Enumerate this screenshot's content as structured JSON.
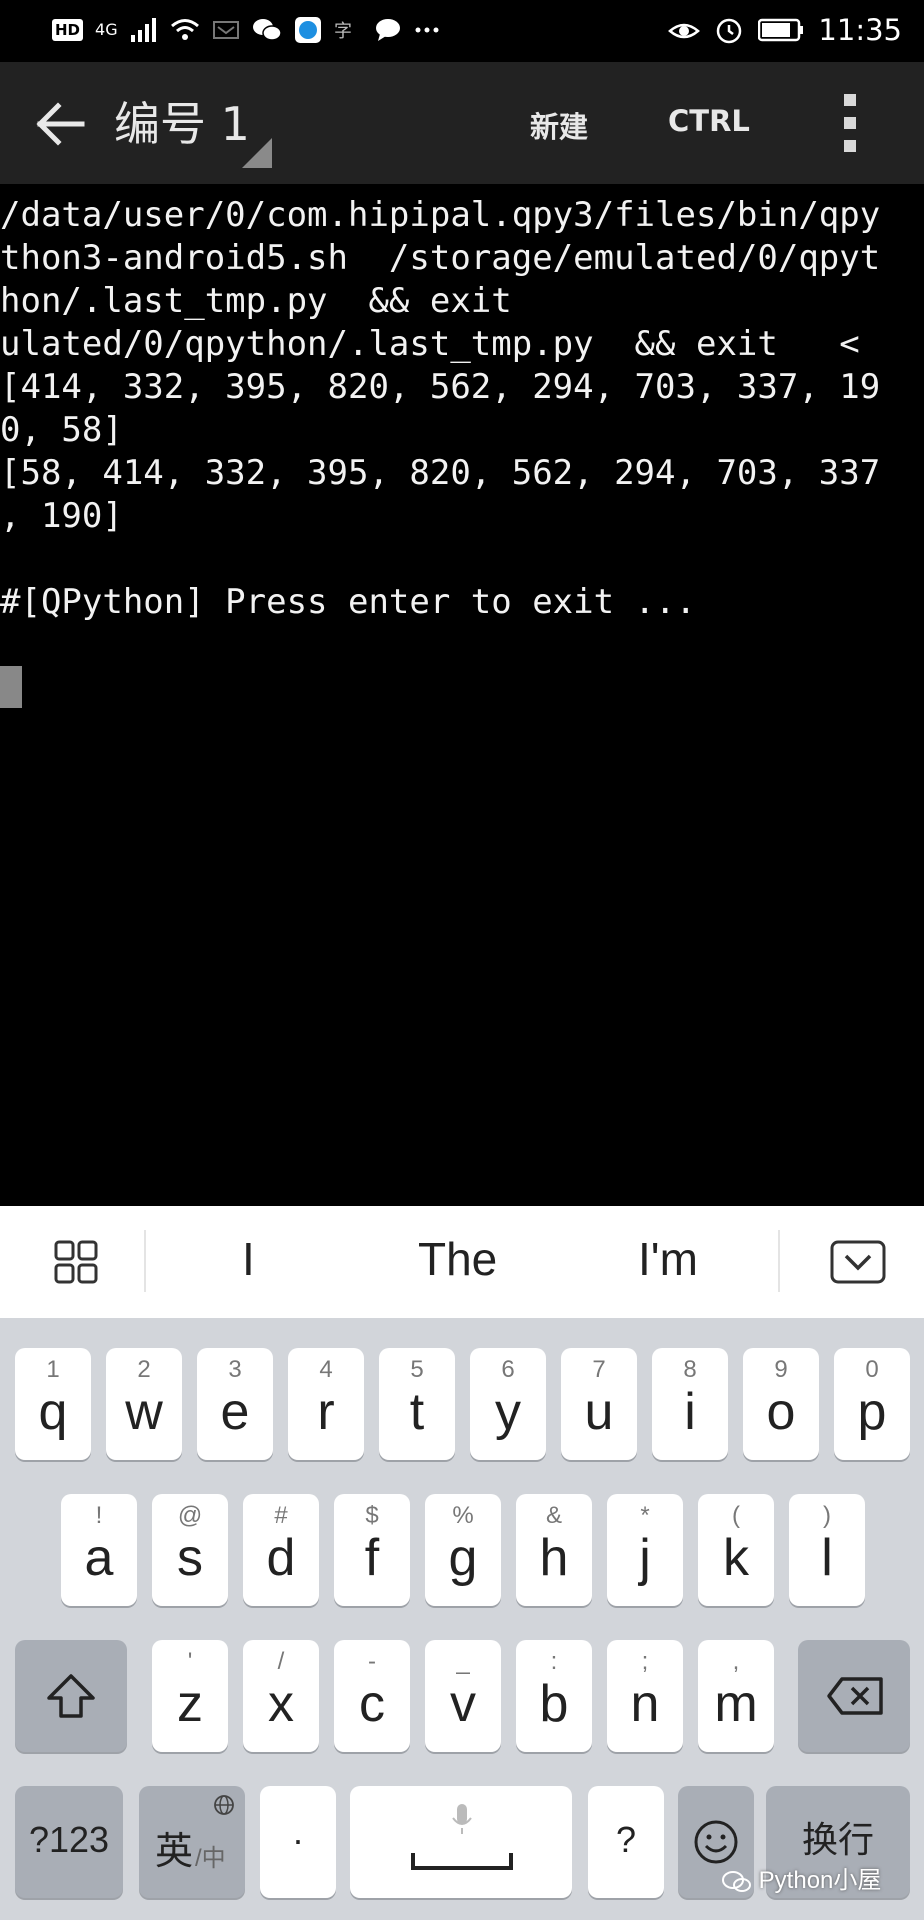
{
  "status_bar": {
    "network_badge": "HD",
    "network_type": "4G",
    "time": "11:35",
    "left_icons": [
      "signal-icon",
      "wifi-icon",
      "notification-icon",
      "wechat-icon",
      "browser-icon",
      "app-icon",
      "chat-bubble-icon",
      "more-dots-icon"
    ],
    "right_icons": [
      "eye-icon",
      "alarm-icon",
      "battery-icon"
    ]
  },
  "app_bar": {
    "title": "编号 1",
    "new_label": "新建",
    "ctrl_label": "CTRL"
  },
  "terminal": {
    "lines": [
      "/data/user/0/com.hipipal.qpy3/files/bin/qpy",
      "thon3-android5.sh  /storage/emulated/0/qpyt",
      "hon/.last_tmp.py  && exit",
      "ulated/0/qpython/.last_tmp.py  && exit   <",
      "[414, 332, 395, 820, 562, 294, 703, 337, 19",
      "0, 58]",
      "[58, 414, 332, 395, 820, 562, 294, 703, 337",
      ", 190]",
      "",
      "#[QPython] Press enter to exit ..."
    ]
  },
  "suggestions": {
    "words": [
      "I",
      "The",
      "I'm"
    ]
  },
  "keyboard": {
    "row1": [
      {
        "num": "1",
        "ch": "q"
      },
      {
        "num": "2",
        "ch": "w"
      },
      {
        "num": "3",
        "ch": "e"
      },
      {
        "num": "4",
        "ch": "r"
      },
      {
        "num": "5",
        "ch": "t"
      },
      {
        "num": "6",
        "ch": "y"
      },
      {
        "num": "7",
        "ch": "u"
      },
      {
        "num": "8",
        "ch": "i"
      },
      {
        "num": "9",
        "ch": "o"
      },
      {
        "num": "0",
        "ch": "p"
      }
    ],
    "row2": [
      {
        "num": "!",
        "ch": "a"
      },
      {
        "num": "@",
        "ch": "s"
      },
      {
        "num": "#",
        "ch": "d"
      },
      {
        "num": "$",
        "ch": "f"
      },
      {
        "num": "%",
        "ch": "g"
      },
      {
        "num": "&",
        "ch": "h"
      },
      {
        "num": "*",
        "ch": "j"
      },
      {
        "num": "(",
        "ch": "k"
      },
      {
        "num": ")",
        "ch": "l"
      }
    ],
    "row3": [
      {
        "num": "'",
        "ch": "z"
      },
      {
        "num": "/",
        "ch": "x"
      },
      {
        "num": "-",
        "ch": "c"
      },
      {
        "num": "_",
        "ch": "v"
      },
      {
        "num": ":",
        "ch": "b"
      },
      {
        "num": ";",
        "ch": "n"
      },
      {
        "num": ",",
        "ch": "m"
      }
    ],
    "symbols_label": "?123",
    "lang_main": "英",
    "lang_sub": "/中",
    "period": "·",
    "question": "?",
    "enter_label": "换行"
  },
  "watermark": "Python小屋"
}
